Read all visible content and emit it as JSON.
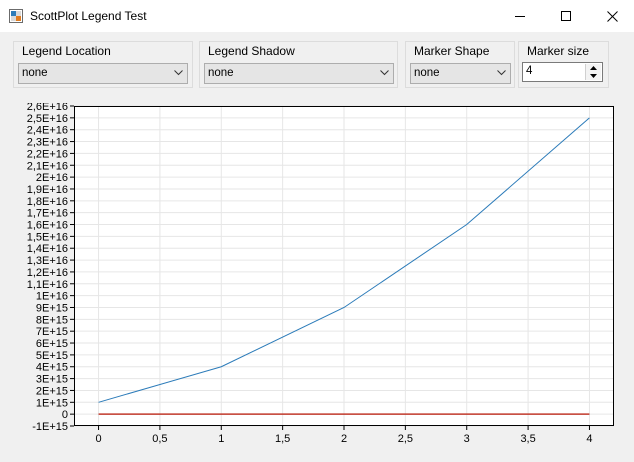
{
  "window": {
    "title": "ScottPlot Legend Test",
    "icon": "scottplot-app-icon",
    "controls": [
      "minimize-icon",
      "maximize-icon",
      "close-icon"
    ]
  },
  "controls": {
    "legend_location": {
      "label": "Legend Location",
      "value": "none"
    },
    "legend_shadow": {
      "label": "Legend Shadow",
      "value": "none"
    },
    "marker_shape": {
      "label": "Marker Shape",
      "value": "none"
    },
    "marker_size": {
      "label": "Marker size",
      "value": "4"
    }
  },
  "chart_data": {
    "type": "line",
    "title": "",
    "xlabel": "",
    "ylabel": "",
    "xlim": [
      -0.2,
      4.2
    ],
    "ylim": [
      -1000000000000000.0,
      2.6e+16
    ],
    "x_ticks": [
      {
        "v": 0,
        "label": "0"
      },
      {
        "v": 0.5,
        "label": "0,5"
      },
      {
        "v": 1,
        "label": "1"
      },
      {
        "v": 1.5,
        "label": "1,5"
      },
      {
        "v": 2,
        "label": "2"
      },
      {
        "v": 2.5,
        "label": "2,5"
      },
      {
        "v": 3,
        "label": "3"
      },
      {
        "v": 3.5,
        "label": "3,5"
      },
      {
        "v": 4,
        "label": "4"
      }
    ],
    "y_ticks": [
      {
        "v": -1000000000000000.0,
        "label": "-1E+15"
      },
      {
        "v": 0,
        "label": "0"
      },
      {
        "v": 1000000000000000.0,
        "label": "1E+15"
      },
      {
        "v": 2000000000000000.0,
        "label": "2E+15"
      },
      {
        "v": 3000000000000000.0,
        "label": "3E+15"
      },
      {
        "v": 4000000000000000.0,
        "label": "4E+15"
      },
      {
        "v": 5000000000000000.0,
        "label": "5E+15"
      },
      {
        "v": 6000000000000000.0,
        "label": "6E+15"
      },
      {
        "v": 7000000000000000.0,
        "label": "7E+15"
      },
      {
        "v": 8000000000000000.0,
        "label": "8E+15"
      },
      {
        "v": 9000000000000000.0,
        "label": "9E+15"
      },
      {
        "v": 1e+16,
        "label": "1E+16"
      },
      {
        "v": 1.1e+16,
        "label": "1,1E+16"
      },
      {
        "v": 1.2e+16,
        "label": "1,2E+16"
      },
      {
        "v": 1.3e+16,
        "label": "1,3E+16"
      },
      {
        "v": 1.4e+16,
        "label": "1,4E+16"
      },
      {
        "v": 1.5e+16,
        "label": "1,5E+16"
      },
      {
        "v": 1.6e+16,
        "label": "1,6E+16"
      },
      {
        "v": 1.7e+16,
        "label": "1,7E+16"
      },
      {
        "v": 1.8e+16,
        "label": "1,8E+16"
      },
      {
        "v": 1.9e+16,
        "label": "1,9E+16"
      },
      {
        "v": 2e+16,
        "label": "2E+16"
      },
      {
        "v": 2.1e+16,
        "label": "2,1E+16"
      },
      {
        "v": 2.2e+16,
        "label": "2,2E+16"
      },
      {
        "v": 2.3e+16,
        "label": "2,3E+16"
      },
      {
        "v": 2.4e+16,
        "label": "2,4E+16"
      },
      {
        "v": 2.5e+16,
        "label": "2,5E+16"
      },
      {
        "v": 2.6e+16,
        "label": "2,6E+16"
      }
    ],
    "grid": true,
    "series": [
      {
        "color": "#2b7bb9",
        "x": [
          0,
          1,
          2,
          3,
          4
        ],
        "y": [
          1000000000000000.0,
          4000000000000000.0,
          9000000000000000.0,
          1.6e+16,
          2.5e+16
        ]
      },
      {
        "color": "#c0392b",
        "x": [
          0,
          1,
          2,
          3,
          4
        ],
        "y": [
          0,
          0,
          0,
          0,
          0
        ]
      }
    ]
  }
}
